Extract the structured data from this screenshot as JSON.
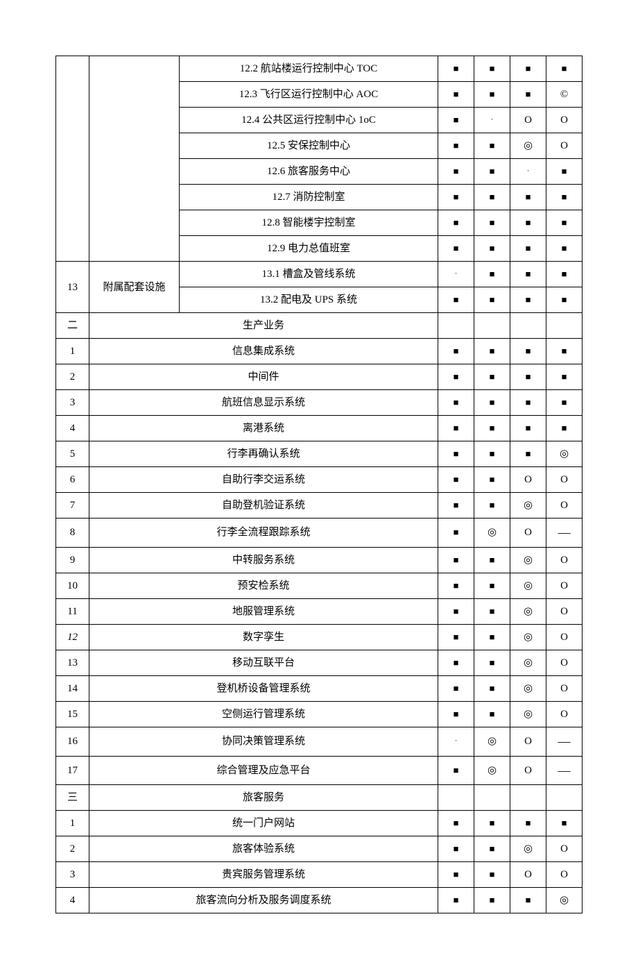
{
  "symbols": {
    "sq": "■",
    "dot": "·",
    "circ": "O",
    "dcirc": "◎",
    "ring": "©",
    "dash": "—"
  },
  "rows": [
    {
      "t": "sub",
      "desc": "12.2 航站楼运行控制中心 TOC",
      "m": [
        "sq",
        "sq",
        "sq",
        "sq"
      ]
    },
    {
      "t": "sub",
      "desc": "12.3 飞行区运行控制中心 AOC",
      "m": [
        "sq",
        "sq",
        "sq",
        "ring"
      ]
    },
    {
      "t": "sub",
      "desc": "12.4 公共区运行控制中心 1oC",
      "m": [
        "sq",
        "dot",
        "circ",
        "circ"
      ]
    },
    {
      "t": "sub",
      "desc": "12.5 安保控制中心",
      "m": [
        "sq",
        "sq",
        "dcirc",
        "circ"
      ]
    },
    {
      "t": "sub",
      "desc": "12.6 旅客服务中心",
      "m": [
        "sq",
        "sq",
        "dot",
        "sq"
      ]
    },
    {
      "t": "sub",
      "desc": "12.7 消防控制室",
      "m": [
        "sq",
        "sq",
        "sq",
        "sq"
      ]
    },
    {
      "t": "sub",
      "desc": "12.8 智能楼宇控制室",
      "m": [
        "sq",
        "sq",
        "sq",
        "sq"
      ]
    },
    {
      "t": "sub",
      "desc": "12.9 电力总值班室",
      "m": [
        "sq",
        "sq",
        "sq",
        "sq"
      ]
    },
    {
      "t": "cat",
      "num": "13",
      "cat": "附属配套设施",
      "subs": [
        {
          "desc": "13.1 槽盒及管线系统",
          "m": [
            "dot",
            "sq",
            "sq",
            "sq"
          ]
        },
        {
          "desc": "13.2 配电及 UPS 系统",
          "m": [
            "sq",
            "sq",
            "sq",
            "sq"
          ]
        }
      ]
    },
    {
      "t": "sec",
      "num": "二",
      "desc": "生产业务"
    },
    {
      "t": "row",
      "num": "1",
      "desc": "信息集成系统",
      "m": [
        "sq",
        "sq",
        "sq",
        "sq"
      ]
    },
    {
      "t": "row",
      "num": "2",
      "desc": "中间件",
      "m": [
        "sq",
        "sq",
        "sq",
        "sq"
      ]
    },
    {
      "t": "row",
      "num": "3",
      "desc": "航班信息显示系统",
      "m": [
        "sq",
        "sq",
        "sq",
        "sq"
      ]
    },
    {
      "t": "row",
      "num": "4",
      "desc": "离港系统",
      "m": [
        "sq",
        "sq",
        "sq",
        "sq"
      ]
    },
    {
      "t": "row",
      "num": "5",
      "desc": "行李再确认系统",
      "m": [
        "sq",
        "sq",
        "sq",
        "dcirc"
      ]
    },
    {
      "t": "row",
      "num": "6",
      "desc": "自助行李交运系统",
      "m": [
        "sq",
        "sq",
        "circ",
        "circ"
      ]
    },
    {
      "t": "row",
      "num": "7",
      "desc": "自助登机验证系统",
      "m": [
        "sq",
        "sq",
        "dcirc",
        "circ"
      ]
    },
    {
      "t": "row",
      "num": "8",
      "desc": "行李全流程跟踪系统",
      "m": [
        "sq",
        "dcirc",
        "circ",
        "dash"
      ]
    },
    {
      "t": "row",
      "num": "9",
      "desc": "中转服务系统",
      "m": [
        "sq",
        "sq",
        "dcirc",
        "circ"
      ]
    },
    {
      "t": "row",
      "num": "10",
      "desc": "预安检系统",
      "m": [
        "sq",
        "sq",
        "dcirc",
        "circ"
      ]
    },
    {
      "t": "row",
      "num": "11",
      "desc": "地服管理系统",
      "m": [
        "sq",
        "sq",
        "dcirc",
        "circ"
      ]
    },
    {
      "t": "row",
      "num": "12",
      "desc": "数字孪生",
      "m": [
        "sq",
        "sq",
        "dcirc",
        "circ"
      ],
      "ital": true
    },
    {
      "t": "row",
      "num": "13",
      "desc": "移动互联平台",
      "m": [
        "sq",
        "sq",
        "dcirc",
        "circ"
      ]
    },
    {
      "t": "row",
      "num": "14",
      "desc": "登机桥设备管理系统",
      "m": [
        "sq",
        "sq",
        "dcirc",
        "circ"
      ]
    },
    {
      "t": "row",
      "num": "15",
      "desc": "空侧运行管理系统",
      "m": [
        "sq",
        "sq",
        "dcirc",
        "circ"
      ]
    },
    {
      "t": "row",
      "num": "16",
      "desc": "协同决策管理系统",
      "m": [
        "dot",
        "dcirc",
        "circ",
        "dash"
      ]
    },
    {
      "t": "row",
      "num": "17",
      "desc": "综合管理及应急平台",
      "m": [
        "sq",
        "dcirc",
        "circ",
        "dash"
      ]
    },
    {
      "t": "sec",
      "num": "三",
      "desc": "旅客服务"
    },
    {
      "t": "row",
      "num": "1",
      "desc": "统一门户网站",
      "m": [
        "sq",
        "sq",
        "sq",
        "sq"
      ]
    },
    {
      "t": "row",
      "num": "2",
      "desc": "旅客体验系统",
      "m": [
        "sq",
        "sq",
        "dcirc",
        "circ"
      ]
    },
    {
      "t": "row",
      "num": "3",
      "desc": "贵宾服务管理系统",
      "m": [
        "sq",
        "sq",
        "circ",
        "circ"
      ]
    },
    {
      "t": "row",
      "num": "4",
      "desc": "旅客流向分析及服务调度系统",
      "m": [
        "sq",
        "sq",
        "sq",
        "dcirc"
      ]
    }
  ]
}
